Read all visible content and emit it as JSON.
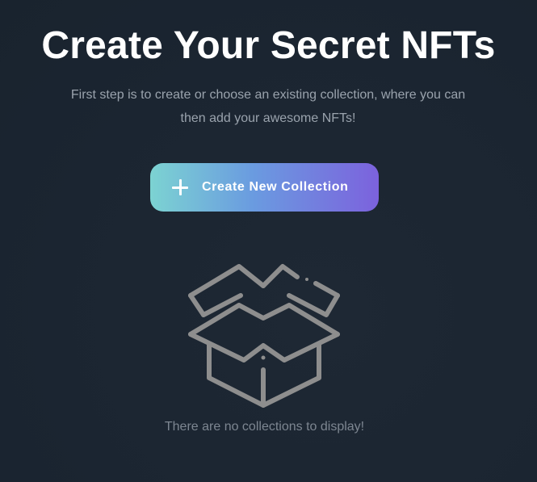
{
  "header": {
    "title": "Create Your Secret NFTs",
    "subtitle": "First step is to create or choose an existing collection, where you can then add your awesome NFTs!"
  },
  "actions": {
    "create_collection_label": "Create New Collection",
    "create_collection_icon": "plus-icon"
  },
  "empty_state": {
    "icon": "open-box-icon",
    "message": "There are no collections to display!"
  },
  "colors": {
    "background": "#1c2733",
    "title": "#ffffff",
    "subtitle": "#9aa3ad",
    "button_gradient_start": "#7cd3d2",
    "button_gradient_mid": "#6a9be0",
    "button_gradient_end": "#7c62dd",
    "empty_icon": "#8e8e8e",
    "empty_text": "#7d8691"
  }
}
